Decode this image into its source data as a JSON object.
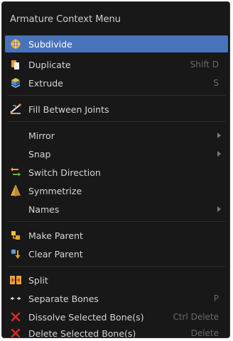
{
  "menu": {
    "title": "Armature Context Menu",
    "items": {
      "subdivide": {
        "label": "Subdivide",
        "icon": "subdivide-icon"
      },
      "duplicate": {
        "label": "Duplicate",
        "shortcut": "Shift D",
        "icon": "duplicate-icon"
      },
      "extrude": {
        "label": "Extrude",
        "shortcut": "S",
        "icon": "extrude-icon"
      },
      "fill": {
        "label": "Fill Between Joints",
        "icon": "fill-icon"
      },
      "mirror": {
        "label": "Mirror"
      },
      "snap": {
        "label": "Snap"
      },
      "switch": {
        "label": "Switch Direction",
        "icon": "switch-direction-icon"
      },
      "symmetrize": {
        "label": "Symmetrize",
        "icon": "symmetrize-icon"
      },
      "names": {
        "label": "Names"
      },
      "make_parent": {
        "label": "Make Parent",
        "icon": "make-parent-icon"
      },
      "clear_parent": {
        "label": "Clear Parent",
        "icon": "clear-parent-icon"
      },
      "split": {
        "label": "Split",
        "icon": "split-icon"
      },
      "separate": {
        "label": "Separate Bones",
        "shortcut": "P",
        "icon": "separate-icon"
      },
      "dissolve": {
        "label": "Dissolve Selected Bone(s)",
        "shortcut": "Ctrl Delete",
        "icon": "x-icon"
      },
      "delete": {
        "label": "Delete Selected Bone(s)",
        "shortcut": "Delete",
        "icon": "x-icon"
      }
    },
    "colors": {
      "background": "#181818",
      "highlight": "#4873ba",
      "delete_icon": "#e02828"
    }
  }
}
